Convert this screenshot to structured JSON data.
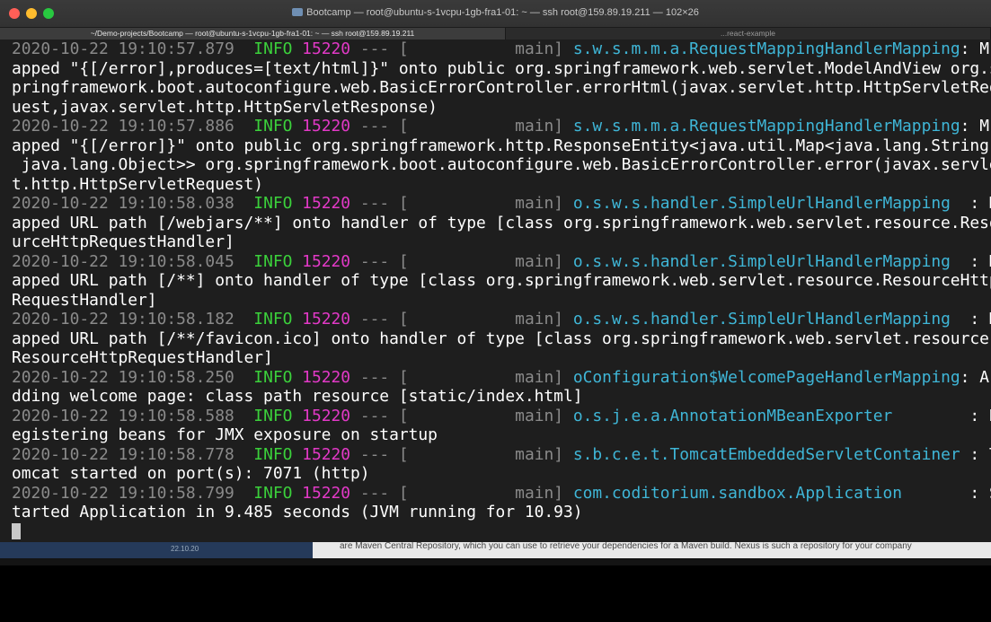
{
  "window": {
    "title": "Bootcamp — root@ubuntu-s-1vcpu-1gb-fra1-01: ~ — ssh root@159.89.19.211 — 102×26",
    "folder_icon": "folder-icon"
  },
  "tabs": [
    {
      "label": "~/Demo-projects/Bootcamp — root@ubuntu-s-1vcpu-1gb-fra1-01: ~ — ssh root@159.89.19.211",
      "active": true
    },
    {
      "label": "...react-example",
      "active": false
    }
  ],
  "log": [
    {
      "ts": "2020-10-22 19:10:57.879",
      "level": "INFO",
      "pid": "15220",
      "sep": "---",
      "thread": "[           main]",
      "logger": "s.w.s.m.m.a.RequestMappingHandlerMapping",
      "colon": ": M",
      "cont": [
        "apped \"{[/error],produces=[text/html]}\" onto public org.springframework.web.servlet.ModelAndView org.s",
        "pringframework.boot.autoconfigure.web.BasicErrorController.errorHtml(javax.servlet.http.HttpServletReq",
        "uest,javax.servlet.http.HttpServletResponse)"
      ]
    },
    {
      "ts": "2020-10-22 19:10:57.886",
      "level": "INFO",
      "pid": "15220",
      "sep": "---",
      "thread": "[           main]",
      "logger": "s.w.s.m.m.a.RequestMappingHandlerMapping",
      "colon": ": M",
      "cont": [
        "apped \"{[/error]}\" onto public org.springframework.http.ResponseEntity<java.util.Map<java.lang.String",
        " java.lang.Object>> org.springframework.boot.autoconfigure.web.BasicErrorController.error(javax.servle",
        "t.http.HttpServletRequest)"
      ]
    },
    {
      "ts": "2020-10-22 19:10:58.038",
      "level": "INFO",
      "pid": "15220",
      "sep": "---",
      "thread": "[           main]",
      "logger": "o.s.w.s.handler.SimpleUrlHandlerMapping ",
      "colon": " : M",
      "cont": [
        "apped URL path [/webjars/**] onto handler of type [class org.springframework.web.servlet.resource.Reso",
        "urceHttpRequestHandler]"
      ]
    },
    {
      "ts": "2020-10-22 19:10:58.045",
      "level": "INFO",
      "pid": "15220",
      "sep": "---",
      "thread": "[           main]",
      "logger": "o.s.w.s.handler.SimpleUrlHandlerMapping ",
      "colon": " : M",
      "cont": [
        "apped URL path [/**] onto handler of type [class org.springframework.web.servlet.resource.ResourceHttp",
        "RequestHandler]"
      ]
    },
    {
      "ts": "2020-10-22 19:10:58.182",
      "level": "INFO",
      "pid": "15220",
      "sep": "---",
      "thread": "[           main]",
      "logger": "o.s.w.s.handler.SimpleUrlHandlerMapping ",
      "colon": " : M",
      "cont": [
        "apped URL path [/**/favicon.ico] onto handler of type [class org.springframework.web.servlet.resource",
        "ResourceHttpRequestHandler]"
      ]
    },
    {
      "ts": "2020-10-22 19:10:58.250",
      "level": "INFO",
      "pid": "15220",
      "sep": "---",
      "thread": "[           main]",
      "logger": "oConfiguration$WelcomePageHandlerMapping",
      "colon": ": A",
      "cont": [
        "dding welcome page: class path resource [static/index.html]"
      ]
    },
    {
      "ts": "2020-10-22 19:10:58.588",
      "level": "INFO",
      "pid": "15220",
      "sep": "---",
      "thread": "[           main]",
      "logger": "o.s.j.e.a.AnnotationMBeanExporter       ",
      "colon": " : R",
      "cont": [
        "egistering beans for JMX exposure on startup"
      ]
    },
    {
      "ts": "2020-10-22 19:10:58.778",
      "level": "INFO",
      "pid": "15220",
      "sep": "---",
      "thread": "[           main]",
      "logger": "s.b.c.e.t.TomcatEmbeddedServletContainer",
      "colon": " : T",
      "cont": [
        "omcat started on port(s): 7071 (http)"
      ]
    },
    {
      "ts": "2020-10-22 19:10:58.799",
      "level": "INFO",
      "pid": "15220",
      "sep": "---",
      "thread": "[           main]",
      "logger": "com.coditorium.sandbox.Application      ",
      "colon": " : S",
      "cont": [
        "tarted Application in 9.485 seconds (JVM running for 10.93)"
      ]
    }
  ],
  "background_window": {
    "date": "22.10.20",
    "text": "are Maven Central Repository, which you can use to retrieve your dependencies for a Maven build. Nexus is such a repository for your company"
  },
  "colors": {
    "info": "#3bd13b",
    "pid": "#e239c7",
    "logger": "#3fb6d7",
    "timestamp": "#8a8a8a"
  }
}
